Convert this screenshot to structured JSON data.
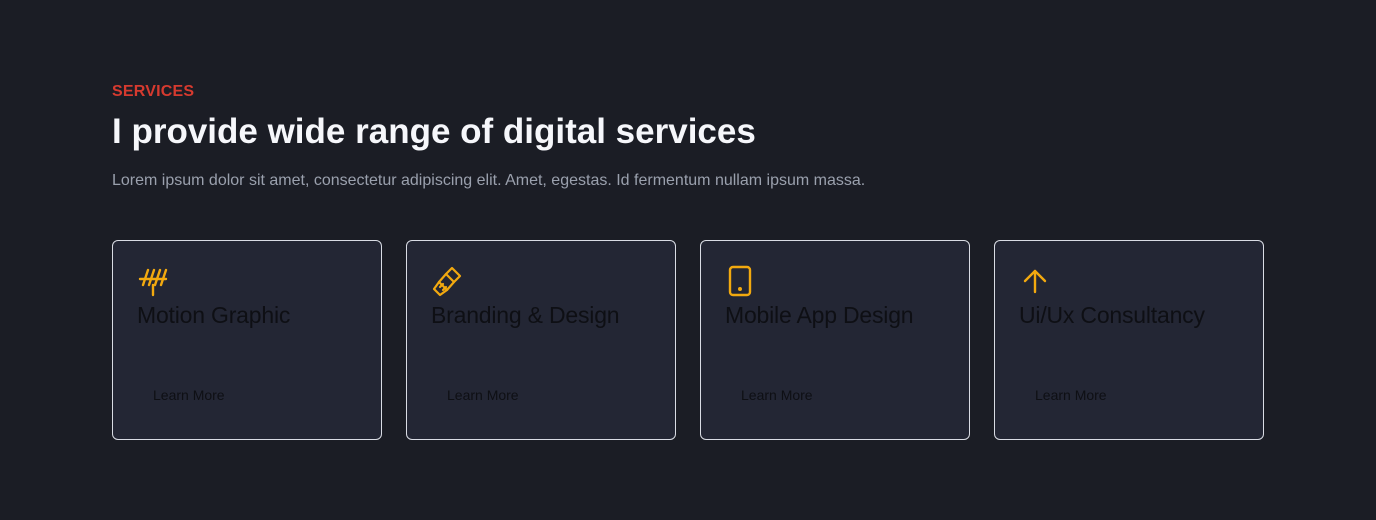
{
  "services": {
    "eyebrow": "SERVICES",
    "title": "I provide wide range of digital services",
    "subtitle": "Lorem ipsum dolor sit amet, consectetur adipiscing elit. Amet, egestas. Id fermentum nullam ipsum massa.",
    "accent_color": "#d63a2f",
    "icon_color": "#f2a90f",
    "cards": [
      {
        "icon": "antenna-icon",
        "title": "Motion Graphic",
        "link_label": "Learn More"
      },
      {
        "icon": "paint-brush-icon",
        "title": "Branding & Design",
        "link_label": "Learn More"
      },
      {
        "icon": "tablet-icon",
        "title": "Mobile App Design",
        "link_label": "Learn More"
      },
      {
        "icon": "arrow-up-icon",
        "title": "Ui/Ux Consultancy",
        "link_label": "Learn More"
      }
    ]
  }
}
